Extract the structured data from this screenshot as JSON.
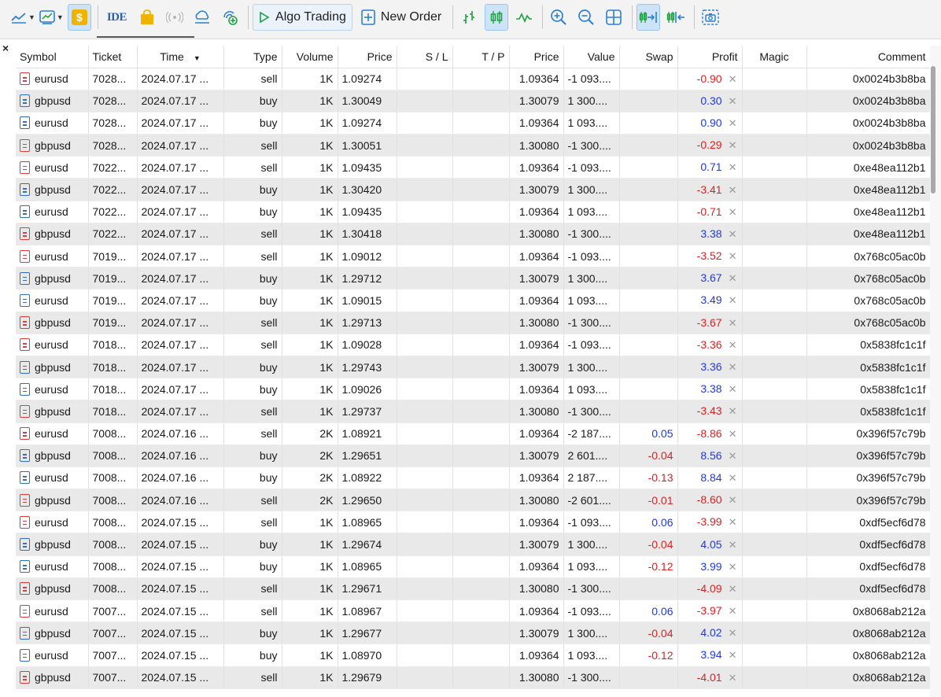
{
  "toolbar": {
    "algo_trading_label": "Algo Trading",
    "new_order_label": "New Order",
    "ide_label": "IDE",
    "dollar_label": "$",
    "colors": {
      "accent_blue": "#2b7fd6",
      "active_bg": "#cde3f7",
      "green": "#1aa23a",
      "gold": "#f0b400"
    }
  },
  "table": {
    "columns": {
      "symbol": "Symbol",
      "ticket": "Ticket",
      "time": "Time",
      "type": "Type",
      "volume": "Volume",
      "price": "Price",
      "sl": "S / L",
      "tp": "T / P",
      "price2": "Price",
      "value": "Value",
      "swap": "Swap",
      "profit": "Profit",
      "magic": "Magic",
      "comment": "Comment"
    },
    "rows": [
      {
        "symbol": "eurusd",
        "ticket": "7028...",
        "time": "2024.07.17 ...",
        "type": "sell",
        "volume": "1K",
        "price": "1.09274",
        "price2": "1.09364",
        "value": "-1 093....",
        "swap": "",
        "profit": "-0.90",
        "comment": "0x0024b3b8ba"
      },
      {
        "symbol": "gbpusd",
        "ticket": "7028...",
        "time": "2024.07.17 ...",
        "type": "buy",
        "volume": "1K",
        "price": "1.30049",
        "price2": "1.30079",
        "value": "1 300....",
        "swap": "",
        "profit": "0.30",
        "comment": "0x0024b3b8ba"
      },
      {
        "symbol": "eurusd",
        "ticket": "7028...",
        "time": "2024.07.17 ...",
        "type": "buy",
        "volume": "1K",
        "price": "1.09274",
        "price2": "1.09364",
        "value": "1 093....",
        "swap": "",
        "profit": "0.90",
        "comment": "0x0024b3b8ba"
      },
      {
        "symbol": "gbpusd",
        "ticket": "7028...",
        "time": "2024.07.17 ...",
        "type": "sell",
        "volume": "1K",
        "price": "1.30051",
        "price2": "1.30080",
        "value": "-1 300....",
        "swap": "",
        "profit": "-0.29",
        "comment": "0x0024b3b8ba"
      },
      {
        "symbol": "eurusd",
        "ticket": "7022...",
        "time": "2024.07.17 ...",
        "type": "sell",
        "volume": "1K",
        "price": "1.09435",
        "price2": "1.09364",
        "value": "-1 093....",
        "swap": "",
        "profit": "0.71",
        "comment": "0xe48ea112b1"
      },
      {
        "symbol": "gbpusd",
        "ticket": "7022...",
        "time": "2024.07.17 ...",
        "type": "buy",
        "volume": "1K",
        "price": "1.30420",
        "price2": "1.30079",
        "value": "1 300....",
        "swap": "",
        "profit": "-3.41",
        "comment": "0xe48ea112b1"
      },
      {
        "symbol": "eurusd",
        "ticket": "7022...",
        "time": "2024.07.17 ...",
        "type": "buy",
        "volume": "1K",
        "price": "1.09435",
        "price2": "1.09364",
        "value": "1 093....",
        "swap": "",
        "profit": "-0.71",
        "comment": "0xe48ea112b1"
      },
      {
        "symbol": "gbpusd",
        "ticket": "7022...",
        "time": "2024.07.17 ...",
        "type": "sell",
        "volume": "1K",
        "price": "1.30418",
        "price2": "1.30080",
        "value": "-1 300....",
        "swap": "",
        "profit": "3.38",
        "comment": "0xe48ea112b1"
      },
      {
        "symbol": "eurusd",
        "ticket": "7019...",
        "time": "2024.07.17 ...",
        "type": "sell",
        "volume": "1K",
        "price": "1.09012",
        "price2": "1.09364",
        "value": "-1 093....",
        "swap": "",
        "profit": "-3.52",
        "comment": "0x768c05ac0b"
      },
      {
        "symbol": "gbpusd",
        "ticket": "7019...",
        "time": "2024.07.17 ...",
        "type": "buy",
        "volume": "1K",
        "price": "1.29712",
        "price2": "1.30079",
        "value": "1 300....",
        "swap": "",
        "profit": "3.67",
        "comment": "0x768c05ac0b"
      },
      {
        "symbol": "eurusd",
        "ticket": "7019...",
        "time": "2024.07.17 ...",
        "type": "buy",
        "volume": "1K",
        "price": "1.09015",
        "price2": "1.09364",
        "value": "1 093....",
        "swap": "",
        "profit": "3.49",
        "comment": "0x768c05ac0b"
      },
      {
        "symbol": "gbpusd",
        "ticket": "7019...",
        "time": "2024.07.17 ...",
        "type": "sell",
        "volume": "1K",
        "price": "1.29713",
        "price2": "1.30080",
        "value": "-1 300....",
        "swap": "",
        "profit": "-3.67",
        "comment": "0x768c05ac0b"
      },
      {
        "symbol": "eurusd",
        "ticket": "7018...",
        "time": "2024.07.17 ...",
        "type": "sell",
        "volume": "1K",
        "price": "1.09028",
        "price2": "1.09364",
        "value": "-1 093....",
        "swap": "",
        "profit": "-3.36",
        "comment": "0x5838fc1c1f"
      },
      {
        "symbol": "gbpusd",
        "ticket": "7018...",
        "time": "2024.07.17 ...",
        "type": "buy",
        "volume": "1K",
        "price": "1.29743",
        "price2": "1.30079",
        "value": "1 300....",
        "swap": "",
        "profit": "3.36",
        "comment": "0x5838fc1c1f"
      },
      {
        "symbol": "eurusd",
        "ticket": "7018...",
        "time": "2024.07.17 ...",
        "type": "buy",
        "volume": "1K",
        "price": "1.09026",
        "price2": "1.09364",
        "value": "1 093....",
        "swap": "",
        "profit": "3.38",
        "comment": "0x5838fc1c1f"
      },
      {
        "symbol": "gbpusd",
        "ticket": "7018...",
        "time": "2024.07.17 ...",
        "type": "sell",
        "volume": "1K",
        "price": "1.29737",
        "price2": "1.30080",
        "value": "-1 300....",
        "swap": "",
        "profit": "-3.43",
        "comment": "0x5838fc1c1f"
      },
      {
        "symbol": "eurusd",
        "ticket": "7008...",
        "time": "2024.07.16 ...",
        "type": "sell",
        "volume": "2K",
        "price": "1.08921",
        "price2": "1.09364",
        "value": "-2 187....",
        "swap": "0.05",
        "profit": "-8.86",
        "comment": "0x396f57c79b"
      },
      {
        "symbol": "gbpusd",
        "ticket": "7008...",
        "time": "2024.07.16 ...",
        "type": "buy",
        "volume": "2K",
        "price": "1.29651",
        "price2": "1.30079",
        "value": "2 601....",
        "swap": "-0.04",
        "profit": "8.56",
        "comment": "0x396f57c79b"
      },
      {
        "symbol": "eurusd",
        "ticket": "7008...",
        "time": "2024.07.16 ...",
        "type": "buy",
        "volume": "2K",
        "price": "1.08922",
        "price2": "1.09364",
        "value": "2 187....",
        "swap": "-0.13",
        "profit": "8.84",
        "comment": "0x396f57c79b"
      },
      {
        "symbol": "gbpusd",
        "ticket": "7008...",
        "time": "2024.07.16 ...",
        "type": "sell",
        "volume": "2K",
        "price": "1.29650",
        "price2": "1.30080",
        "value": "-2 601....",
        "swap": "-0.01",
        "profit": "-8.60",
        "comment": "0x396f57c79b"
      },
      {
        "symbol": "eurusd",
        "ticket": "7008...",
        "time": "2024.07.15 ...",
        "type": "sell",
        "volume": "1K",
        "price": "1.08965",
        "price2": "1.09364",
        "value": "-1 093....",
        "swap": "0.06",
        "profit": "-3.99",
        "comment": "0xdf5ecf6d78"
      },
      {
        "symbol": "gbpusd",
        "ticket": "7008...",
        "time": "2024.07.15 ...",
        "type": "buy",
        "volume": "1K",
        "price": "1.29674",
        "price2": "1.30079",
        "value": "1 300....",
        "swap": "-0.04",
        "profit": "4.05",
        "comment": "0xdf5ecf6d78"
      },
      {
        "symbol": "eurusd",
        "ticket": "7008...",
        "time": "2024.07.15 ...",
        "type": "buy",
        "volume": "1K",
        "price": "1.08965",
        "price2": "1.09364",
        "value": "1 093....",
        "swap": "-0.12",
        "profit": "3.99",
        "comment": "0xdf5ecf6d78"
      },
      {
        "symbol": "gbpusd",
        "ticket": "7008...",
        "time": "2024.07.15 ...",
        "type": "sell",
        "volume": "1K",
        "price": "1.29671",
        "price2": "1.30080",
        "value": "-1 300....",
        "swap": "",
        "profit": "-4.09",
        "comment": "0xdf5ecf6d78"
      },
      {
        "symbol": "eurusd",
        "ticket": "7007...",
        "time": "2024.07.15 ...",
        "type": "sell",
        "volume": "1K",
        "price": "1.08967",
        "price2": "1.09364",
        "value": "-1 093....",
        "swap": "0.06",
        "profit": "-3.97",
        "comment": "0x8068ab212a"
      },
      {
        "symbol": "gbpusd",
        "ticket": "7007...",
        "time": "2024.07.15 ...",
        "type": "buy",
        "volume": "1K",
        "price": "1.29677",
        "price2": "1.30079",
        "value": "1 300....",
        "swap": "-0.04",
        "profit": "4.02",
        "comment": "0x8068ab212a"
      },
      {
        "symbol": "eurusd",
        "ticket": "7007...",
        "time": "2024.07.15 ...",
        "type": "buy",
        "volume": "1K",
        "price": "1.08970",
        "price2": "1.09364",
        "value": "1 093....",
        "swap": "-0.12",
        "profit": "3.94",
        "comment": "0x8068ab212a"
      },
      {
        "symbol": "gbpusd",
        "ticket": "7007...",
        "time": "2024.07.15 ...",
        "type": "sell",
        "volume": "1K",
        "price": "1.29679",
        "price2": "1.30080",
        "value": "-1 300....",
        "swap": "",
        "profit": "-4.01",
        "comment": "0x8068ab212a"
      }
    ]
  },
  "colors": {
    "negative": "#e01e1e",
    "positive": "#1f39e6",
    "sell_icon": "#e03b3b",
    "buy_icon": "#2e6fc6",
    "alt_row": "#e9e9e9"
  }
}
